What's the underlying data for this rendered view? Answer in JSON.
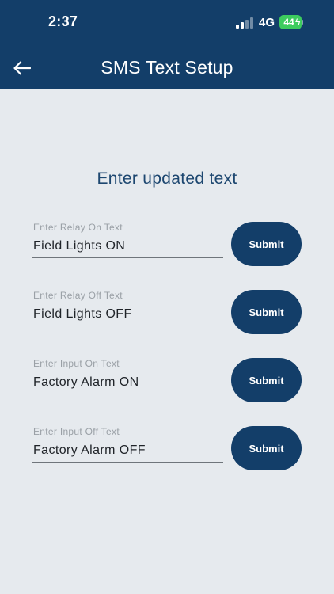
{
  "status_bar": {
    "time": "2:37",
    "network": "4G",
    "battery": "44",
    "battery_color": "#3DCC5E"
  },
  "header": {
    "title": "SMS Text Setup",
    "back_icon": "arrow-left-icon",
    "background": "#133E69"
  },
  "main": {
    "heading": "Enter updated text",
    "fields": [
      {
        "label": "Enter Relay On Text",
        "value": "Field Lights ON",
        "button": "Submit"
      },
      {
        "label": "Enter Relay Off Text",
        "value": "Field Lights OFF",
        "button": "Submit"
      },
      {
        "label": "Enter Input On Text",
        "value": "Factory Alarm ON",
        "button": "Submit"
      },
      {
        "label": "Enter Input Off Text",
        "value": "Factory Alarm OFF",
        "button": "Submit"
      }
    ]
  }
}
